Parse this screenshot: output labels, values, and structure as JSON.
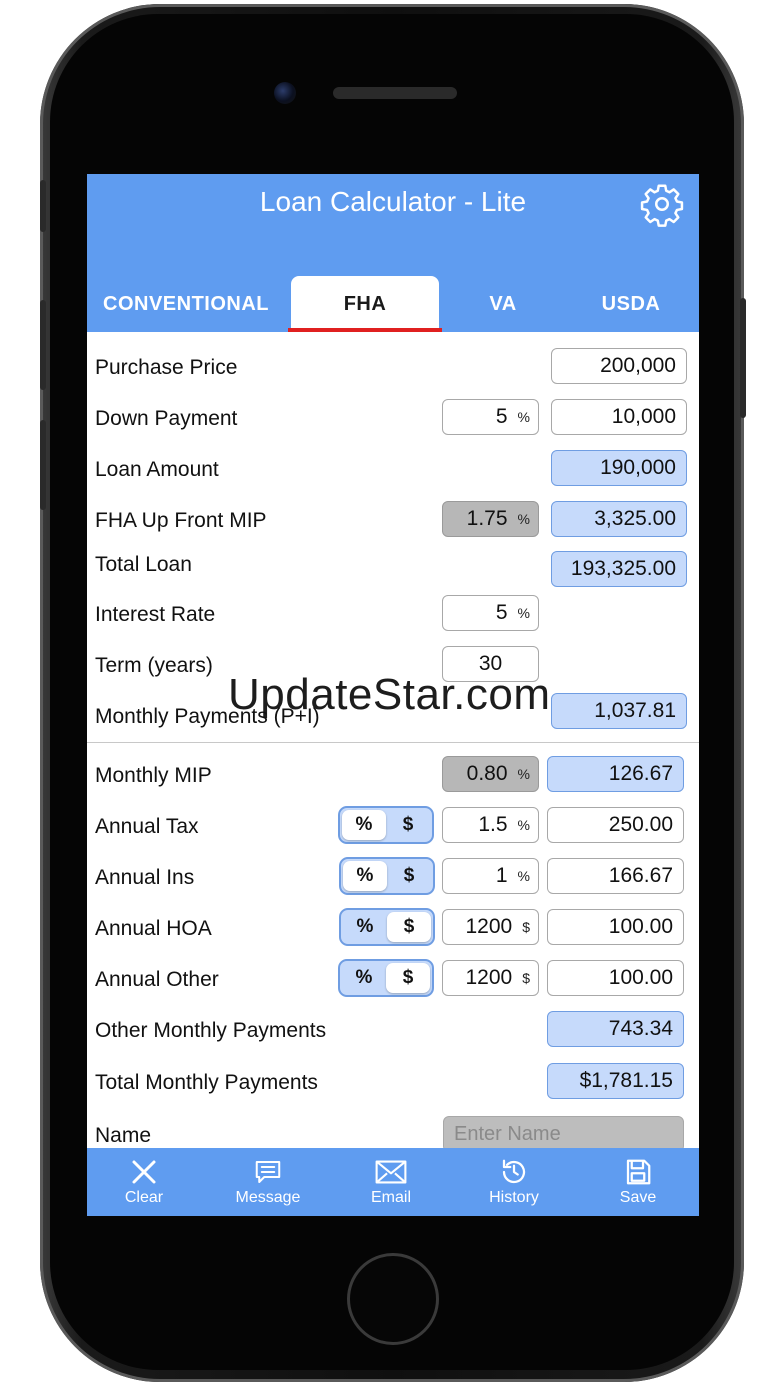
{
  "header": {
    "title": "Loan Calculator - Lite"
  },
  "tabs": [
    {
      "label": "CONVENTIONAL"
    },
    {
      "label": "FHA"
    },
    {
      "label": "VA"
    },
    {
      "label": "USDA"
    }
  ],
  "active_tab": "FHA",
  "form": {
    "purchase_price": {
      "label": "Purchase Price",
      "value": "200,000"
    },
    "down_payment": {
      "label": "Down Payment",
      "percent": "5",
      "value": "10,000"
    },
    "loan_amount": {
      "label": "Loan Amount",
      "value": "190,000"
    },
    "fha_mip": {
      "label": "FHA Up Front MIP",
      "percent": "1.75",
      "value": "3,325.00"
    },
    "total_loan": {
      "label": "Total Loan",
      "value": "193,325.00"
    },
    "interest_rate": {
      "label": "Interest Rate",
      "value": "5"
    },
    "term": {
      "label": "Term (years)",
      "value": "30"
    },
    "monthly_payments": {
      "label": "Monthly Payments (P+I)",
      "value": "1,037.81"
    },
    "monthly_mip": {
      "label": "Monthly MIP",
      "percent": "0.80",
      "value": "126.67"
    },
    "annual_tax": {
      "label": "Annual Tax",
      "mode": "%",
      "input": "1.5",
      "unit": "%",
      "value": "250.00"
    },
    "annual_ins": {
      "label": "Annual Ins",
      "mode": "%",
      "input": "1",
      "unit": "%",
      "value": "166.67"
    },
    "annual_hoa": {
      "label": "Annual HOA",
      "mode": "$",
      "input": "1200",
      "unit": "$",
      "value": "100.00"
    },
    "annual_other": {
      "label": "Annual Other",
      "mode": "$",
      "input": "1200",
      "unit": "$",
      "value": "100.00"
    },
    "other_monthly": {
      "label": "Other Monthly Payments",
      "value": "743.34"
    },
    "total_monthly": {
      "label": "Total Monthly Payments",
      "value": "$1,781.15"
    },
    "name": {
      "label": "Name",
      "placeholder": "Enter Name"
    }
  },
  "units": {
    "percent": "%",
    "dollar": "$"
  },
  "toggle_options": {
    "percent": "%",
    "dollar": "$"
  },
  "toolbar": {
    "clear": "Clear",
    "message": "Message",
    "email": "Email",
    "history": "History",
    "save": "Save"
  },
  "watermark": "UpdateStar.com",
  "colors": {
    "accent": "#5f9cf0",
    "highlight_field": "#c6dafb",
    "disabled_field": "#b7b7b7",
    "tab_underline": "#e02020"
  },
  "icons": [
    "gear-icon",
    "close-icon",
    "message-icon",
    "email-icon",
    "history-icon",
    "save-icon"
  ]
}
